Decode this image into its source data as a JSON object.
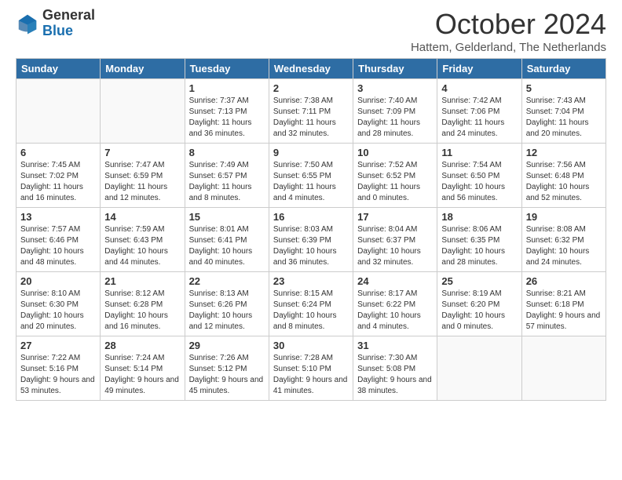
{
  "header": {
    "logo_general": "General",
    "logo_blue": "Blue",
    "title": "October 2024",
    "location": "Hattem, Gelderland, The Netherlands"
  },
  "days_of_week": [
    "Sunday",
    "Monday",
    "Tuesday",
    "Wednesday",
    "Thursday",
    "Friday",
    "Saturday"
  ],
  "weeks": [
    [
      {
        "day": "",
        "info": ""
      },
      {
        "day": "",
        "info": ""
      },
      {
        "day": "1",
        "info": "Sunrise: 7:37 AM\nSunset: 7:13 PM\nDaylight: 11 hours and 36 minutes."
      },
      {
        "day": "2",
        "info": "Sunrise: 7:38 AM\nSunset: 7:11 PM\nDaylight: 11 hours and 32 minutes."
      },
      {
        "day": "3",
        "info": "Sunrise: 7:40 AM\nSunset: 7:09 PM\nDaylight: 11 hours and 28 minutes."
      },
      {
        "day": "4",
        "info": "Sunrise: 7:42 AM\nSunset: 7:06 PM\nDaylight: 11 hours and 24 minutes."
      },
      {
        "day": "5",
        "info": "Sunrise: 7:43 AM\nSunset: 7:04 PM\nDaylight: 11 hours and 20 minutes."
      }
    ],
    [
      {
        "day": "6",
        "info": "Sunrise: 7:45 AM\nSunset: 7:02 PM\nDaylight: 11 hours and 16 minutes."
      },
      {
        "day": "7",
        "info": "Sunrise: 7:47 AM\nSunset: 6:59 PM\nDaylight: 11 hours and 12 minutes."
      },
      {
        "day": "8",
        "info": "Sunrise: 7:49 AM\nSunset: 6:57 PM\nDaylight: 11 hours and 8 minutes."
      },
      {
        "day": "9",
        "info": "Sunrise: 7:50 AM\nSunset: 6:55 PM\nDaylight: 11 hours and 4 minutes."
      },
      {
        "day": "10",
        "info": "Sunrise: 7:52 AM\nSunset: 6:52 PM\nDaylight: 11 hours and 0 minutes."
      },
      {
        "day": "11",
        "info": "Sunrise: 7:54 AM\nSunset: 6:50 PM\nDaylight: 10 hours and 56 minutes."
      },
      {
        "day": "12",
        "info": "Sunrise: 7:56 AM\nSunset: 6:48 PM\nDaylight: 10 hours and 52 minutes."
      }
    ],
    [
      {
        "day": "13",
        "info": "Sunrise: 7:57 AM\nSunset: 6:46 PM\nDaylight: 10 hours and 48 minutes."
      },
      {
        "day": "14",
        "info": "Sunrise: 7:59 AM\nSunset: 6:43 PM\nDaylight: 10 hours and 44 minutes."
      },
      {
        "day": "15",
        "info": "Sunrise: 8:01 AM\nSunset: 6:41 PM\nDaylight: 10 hours and 40 minutes."
      },
      {
        "day": "16",
        "info": "Sunrise: 8:03 AM\nSunset: 6:39 PM\nDaylight: 10 hours and 36 minutes."
      },
      {
        "day": "17",
        "info": "Sunrise: 8:04 AM\nSunset: 6:37 PM\nDaylight: 10 hours and 32 minutes."
      },
      {
        "day": "18",
        "info": "Sunrise: 8:06 AM\nSunset: 6:35 PM\nDaylight: 10 hours and 28 minutes."
      },
      {
        "day": "19",
        "info": "Sunrise: 8:08 AM\nSunset: 6:32 PM\nDaylight: 10 hours and 24 minutes."
      }
    ],
    [
      {
        "day": "20",
        "info": "Sunrise: 8:10 AM\nSunset: 6:30 PM\nDaylight: 10 hours and 20 minutes."
      },
      {
        "day": "21",
        "info": "Sunrise: 8:12 AM\nSunset: 6:28 PM\nDaylight: 10 hours and 16 minutes."
      },
      {
        "day": "22",
        "info": "Sunrise: 8:13 AM\nSunset: 6:26 PM\nDaylight: 10 hours and 12 minutes."
      },
      {
        "day": "23",
        "info": "Sunrise: 8:15 AM\nSunset: 6:24 PM\nDaylight: 10 hours and 8 minutes."
      },
      {
        "day": "24",
        "info": "Sunrise: 8:17 AM\nSunset: 6:22 PM\nDaylight: 10 hours and 4 minutes."
      },
      {
        "day": "25",
        "info": "Sunrise: 8:19 AM\nSunset: 6:20 PM\nDaylight: 10 hours and 0 minutes."
      },
      {
        "day": "26",
        "info": "Sunrise: 8:21 AM\nSunset: 6:18 PM\nDaylight: 9 hours and 57 minutes."
      }
    ],
    [
      {
        "day": "27",
        "info": "Sunrise: 7:22 AM\nSunset: 5:16 PM\nDaylight: 9 hours and 53 minutes."
      },
      {
        "day": "28",
        "info": "Sunrise: 7:24 AM\nSunset: 5:14 PM\nDaylight: 9 hours and 49 minutes."
      },
      {
        "day": "29",
        "info": "Sunrise: 7:26 AM\nSunset: 5:12 PM\nDaylight: 9 hours and 45 minutes."
      },
      {
        "day": "30",
        "info": "Sunrise: 7:28 AM\nSunset: 5:10 PM\nDaylight: 9 hours and 41 minutes."
      },
      {
        "day": "31",
        "info": "Sunrise: 7:30 AM\nSunset: 5:08 PM\nDaylight: 9 hours and 38 minutes."
      },
      {
        "day": "",
        "info": ""
      },
      {
        "day": "",
        "info": ""
      }
    ]
  ]
}
